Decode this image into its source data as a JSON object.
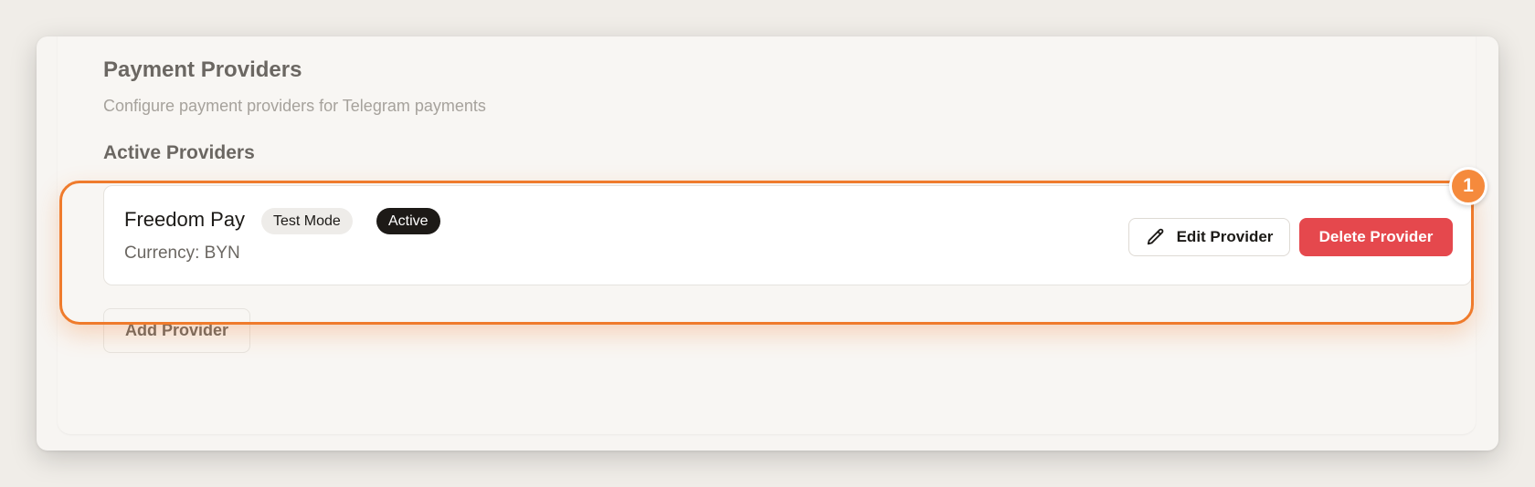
{
  "payment_providers": {
    "title": "Payment Providers",
    "description": "Configure payment providers for Telegram payments",
    "active_heading": "Active Providers",
    "providers": [
      {
        "name": "Freedom Pay",
        "badges": [
          "Test Mode",
          "Active"
        ],
        "currency_label": "Currency:",
        "currency_value": "BYN",
        "edit_label": "Edit Provider",
        "delete_label": "Delete Provider"
      }
    ],
    "add_label": "Add Provider"
  },
  "annotation": {
    "number": "1",
    "color": "#ef7b2c"
  },
  "colors": {
    "delete": "#e5484d",
    "active_badge": "#1d1a17"
  },
  "icons": {
    "edit": "pencil-icon"
  }
}
